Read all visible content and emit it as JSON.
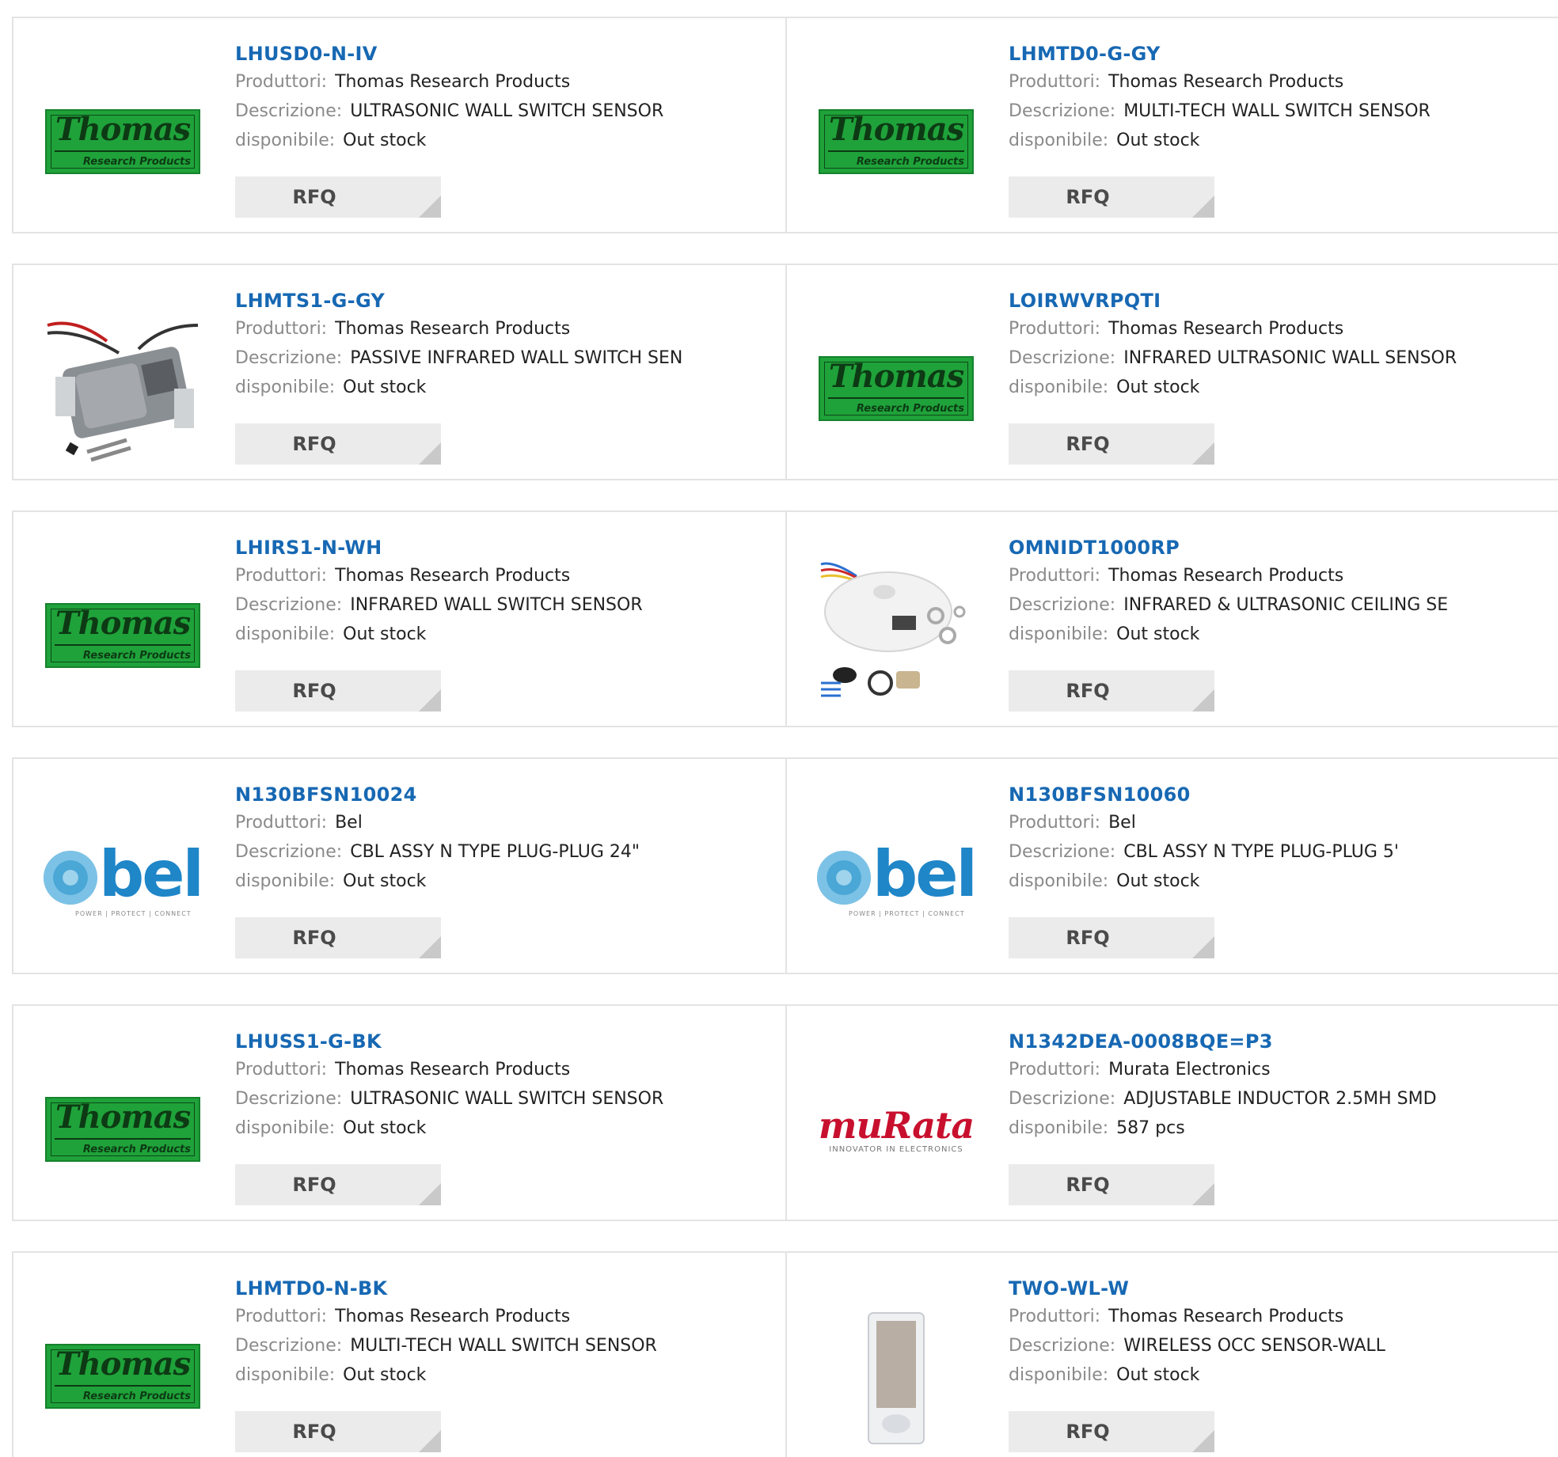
{
  "labels": {
    "manufacturer": "Produttori:",
    "description": "Descrizione:",
    "availability": "disponibile:",
    "rfq": "RFQ"
  },
  "products": [
    {
      "part": "LHUSD0-N-IV",
      "manufacturer": "Thomas Research Products",
      "description": "ULTRASONIC WALL SWITCH SENSOR",
      "availability": "Out stock",
      "image": "thomas-logo"
    },
    {
      "part": "LHMTD0-G-GY",
      "manufacturer": "Thomas Research Products",
      "description": "MULTI-TECH WALL SWITCH SENSOR",
      "availability": "Out stock",
      "image": "thomas-logo"
    },
    {
      "part": "LHMTS1-G-GY",
      "manufacturer": "Thomas Research Products",
      "description": "PASSIVE INFRARED WALL SWITCH SEN",
      "availability": "Out stock",
      "image": "wall-switch-sensor-photo"
    },
    {
      "part": "LOIRWVRPQTI",
      "manufacturer": "Thomas Research Products",
      "description": "INFRARED ULTRASONIC WALL SENSOR",
      "availability": "Out stock",
      "image": "thomas-logo"
    },
    {
      "part": "LHIRS1-N-WH",
      "manufacturer": "Thomas Research Products",
      "description": "INFRARED WALL SWITCH SENSOR",
      "availability": "Out stock",
      "image": "thomas-logo"
    },
    {
      "part": "OMNIDT1000RP",
      "manufacturer": "Thomas Research Products",
      "description": "INFRARED & ULTRASONIC CEILING SE",
      "availability": "Out stock",
      "image": "ceiling-sensor-photo"
    },
    {
      "part": "N130BFSN10024",
      "manufacturer": "Bel",
      "description": "CBL ASSY N TYPE PLUG-PLUG 24\"",
      "availability": "Out stock",
      "image": "bel-logo"
    },
    {
      "part": "N130BFSN10060",
      "manufacturer": "Bel",
      "description": "CBL ASSY N TYPE PLUG-PLUG 5'",
      "availability": "Out stock",
      "image": "bel-logo"
    },
    {
      "part": "LHUSS1-G-BK",
      "manufacturer": "Thomas Research Products",
      "description": "ULTRASONIC WALL SWITCH SENSOR",
      "availability": "Out stock",
      "image": "thomas-logo"
    },
    {
      "part": "N1342DEA-0008BQE=P3",
      "manufacturer": "Murata Electronics",
      "description": "ADJUSTABLE INDUCTOR 2.5MH SMD",
      "availability": "587 pcs",
      "image": "murata-logo"
    },
    {
      "part": "LHMTD0-N-BK",
      "manufacturer": "Thomas Research Products",
      "description": "MULTI-TECH WALL SWITCH SENSOR",
      "availability": "Out stock",
      "image": "thomas-logo"
    },
    {
      "part": "TWO-WL-W",
      "manufacturer": "Thomas Research Products",
      "description": "WIRELESS OCC SENSOR-WALL",
      "availability": "Out stock",
      "image": "wireless-wall-sensor-photo"
    }
  ],
  "logos": {
    "thomas_word": "Thomas",
    "thomas_sub": "Research Products",
    "bel_word": "bel",
    "bel_tag": "POWER | PROTECT | CONNECT",
    "murata_word": "muRata",
    "murata_tag": "INNOVATOR IN ELECTRONICS"
  },
  "colors": {
    "part_link": "#1768b3",
    "label": "#8a8a8a",
    "rfq_bg": "#ebebeb",
    "thomas_green": "#1fa23a",
    "bel_blue": "#1f86c8",
    "murata_red": "#c8102e"
  }
}
